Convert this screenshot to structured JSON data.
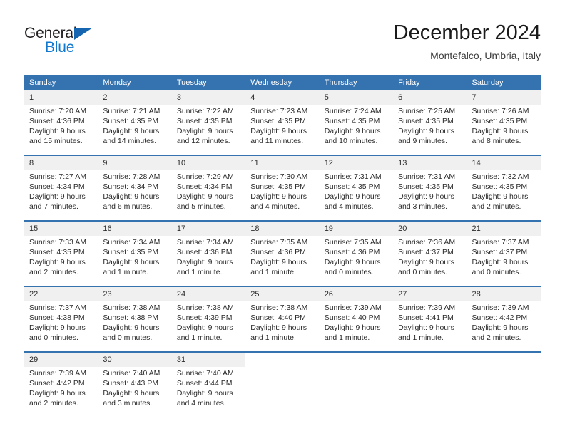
{
  "brand": {
    "name_part1": "General",
    "name_part2": "Blue",
    "triangle_color": "#1565b0",
    "blue_text_color": "#1279cf",
    "dark_text_color": "#231f20"
  },
  "header": {
    "title": "December 2024",
    "subtitle": "Montefalco, Umbria, Italy"
  },
  "theme": {
    "header_band_color": "#3572b0",
    "daynum_band_color": "#f0f0f0",
    "cell_background": "#ffffff",
    "text_color": "#2b2b2b"
  },
  "weekdays": [
    "Sunday",
    "Monday",
    "Tuesday",
    "Wednesday",
    "Thursday",
    "Friday",
    "Saturday"
  ],
  "weeks": [
    {
      "days": [
        {
          "num": "1",
          "sunrise": "Sunrise: 7:20 AM",
          "sunset": "Sunset: 4:36 PM",
          "daylight1": "Daylight: 9 hours",
          "daylight2": "and 15 minutes."
        },
        {
          "num": "2",
          "sunrise": "Sunrise: 7:21 AM",
          "sunset": "Sunset: 4:35 PM",
          "daylight1": "Daylight: 9 hours",
          "daylight2": "and 14 minutes."
        },
        {
          "num": "3",
          "sunrise": "Sunrise: 7:22 AM",
          "sunset": "Sunset: 4:35 PM",
          "daylight1": "Daylight: 9 hours",
          "daylight2": "and 12 minutes."
        },
        {
          "num": "4",
          "sunrise": "Sunrise: 7:23 AM",
          "sunset": "Sunset: 4:35 PM",
          "daylight1": "Daylight: 9 hours",
          "daylight2": "and 11 minutes."
        },
        {
          "num": "5",
          "sunrise": "Sunrise: 7:24 AM",
          "sunset": "Sunset: 4:35 PM",
          "daylight1": "Daylight: 9 hours",
          "daylight2": "and 10 minutes."
        },
        {
          "num": "6",
          "sunrise": "Sunrise: 7:25 AM",
          "sunset": "Sunset: 4:35 PM",
          "daylight1": "Daylight: 9 hours",
          "daylight2": "and 9 minutes."
        },
        {
          "num": "7",
          "sunrise": "Sunrise: 7:26 AM",
          "sunset": "Sunset: 4:35 PM",
          "daylight1": "Daylight: 9 hours",
          "daylight2": "and 8 minutes."
        }
      ]
    },
    {
      "days": [
        {
          "num": "8",
          "sunrise": "Sunrise: 7:27 AM",
          "sunset": "Sunset: 4:34 PM",
          "daylight1": "Daylight: 9 hours",
          "daylight2": "and 7 minutes."
        },
        {
          "num": "9",
          "sunrise": "Sunrise: 7:28 AM",
          "sunset": "Sunset: 4:34 PM",
          "daylight1": "Daylight: 9 hours",
          "daylight2": "and 6 minutes."
        },
        {
          "num": "10",
          "sunrise": "Sunrise: 7:29 AM",
          "sunset": "Sunset: 4:34 PM",
          "daylight1": "Daylight: 9 hours",
          "daylight2": "and 5 minutes."
        },
        {
          "num": "11",
          "sunrise": "Sunrise: 7:30 AM",
          "sunset": "Sunset: 4:35 PM",
          "daylight1": "Daylight: 9 hours",
          "daylight2": "and 4 minutes."
        },
        {
          "num": "12",
          "sunrise": "Sunrise: 7:31 AM",
          "sunset": "Sunset: 4:35 PM",
          "daylight1": "Daylight: 9 hours",
          "daylight2": "and 4 minutes."
        },
        {
          "num": "13",
          "sunrise": "Sunrise: 7:31 AM",
          "sunset": "Sunset: 4:35 PM",
          "daylight1": "Daylight: 9 hours",
          "daylight2": "and 3 minutes."
        },
        {
          "num": "14",
          "sunrise": "Sunrise: 7:32 AM",
          "sunset": "Sunset: 4:35 PM",
          "daylight1": "Daylight: 9 hours",
          "daylight2": "and 2 minutes."
        }
      ]
    },
    {
      "days": [
        {
          "num": "15",
          "sunrise": "Sunrise: 7:33 AM",
          "sunset": "Sunset: 4:35 PM",
          "daylight1": "Daylight: 9 hours",
          "daylight2": "and 2 minutes."
        },
        {
          "num": "16",
          "sunrise": "Sunrise: 7:34 AM",
          "sunset": "Sunset: 4:35 PM",
          "daylight1": "Daylight: 9 hours",
          "daylight2": "and 1 minute."
        },
        {
          "num": "17",
          "sunrise": "Sunrise: 7:34 AM",
          "sunset": "Sunset: 4:36 PM",
          "daylight1": "Daylight: 9 hours",
          "daylight2": "and 1 minute."
        },
        {
          "num": "18",
          "sunrise": "Sunrise: 7:35 AM",
          "sunset": "Sunset: 4:36 PM",
          "daylight1": "Daylight: 9 hours",
          "daylight2": "and 1 minute."
        },
        {
          "num": "19",
          "sunrise": "Sunrise: 7:35 AM",
          "sunset": "Sunset: 4:36 PM",
          "daylight1": "Daylight: 9 hours",
          "daylight2": "and 0 minutes."
        },
        {
          "num": "20",
          "sunrise": "Sunrise: 7:36 AM",
          "sunset": "Sunset: 4:37 PM",
          "daylight1": "Daylight: 9 hours",
          "daylight2": "and 0 minutes."
        },
        {
          "num": "21",
          "sunrise": "Sunrise: 7:37 AM",
          "sunset": "Sunset: 4:37 PM",
          "daylight1": "Daylight: 9 hours",
          "daylight2": "and 0 minutes."
        }
      ]
    },
    {
      "days": [
        {
          "num": "22",
          "sunrise": "Sunrise: 7:37 AM",
          "sunset": "Sunset: 4:38 PM",
          "daylight1": "Daylight: 9 hours",
          "daylight2": "and 0 minutes."
        },
        {
          "num": "23",
          "sunrise": "Sunrise: 7:38 AM",
          "sunset": "Sunset: 4:38 PM",
          "daylight1": "Daylight: 9 hours",
          "daylight2": "and 0 minutes."
        },
        {
          "num": "24",
          "sunrise": "Sunrise: 7:38 AM",
          "sunset": "Sunset: 4:39 PM",
          "daylight1": "Daylight: 9 hours",
          "daylight2": "and 1 minute."
        },
        {
          "num": "25",
          "sunrise": "Sunrise: 7:38 AM",
          "sunset": "Sunset: 4:40 PM",
          "daylight1": "Daylight: 9 hours",
          "daylight2": "and 1 minute."
        },
        {
          "num": "26",
          "sunrise": "Sunrise: 7:39 AM",
          "sunset": "Sunset: 4:40 PM",
          "daylight1": "Daylight: 9 hours",
          "daylight2": "and 1 minute."
        },
        {
          "num": "27",
          "sunrise": "Sunrise: 7:39 AM",
          "sunset": "Sunset: 4:41 PM",
          "daylight1": "Daylight: 9 hours",
          "daylight2": "and 1 minute."
        },
        {
          "num": "28",
          "sunrise": "Sunrise: 7:39 AM",
          "sunset": "Sunset: 4:42 PM",
          "daylight1": "Daylight: 9 hours",
          "daylight2": "and 2 minutes."
        }
      ]
    },
    {
      "days": [
        {
          "num": "29",
          "sunrise": "Sunrise: 7:39 AM",
          "sunset": "Sunset: 4:42 PM",
          "daylight1": "Daylight: 9 hours",
          "daylight2": "and 2 minutes."
        },
        {
          "num": "30",
          "sunrise": "Sunrise: 7:40 AM",
          "sunset": "Sunset: 4:43 PM",
          "daylight1": "Daylight: 9 hours",
          "daylight2": "and 3 minutes."
        },
        {
          "num": "31",
          "sunrise": "Sunrise: 7:40 AM",
          "sunset": "Sunset: 4:44 PM",
          "daylight1": "Daylight: 9 hours",
          "daylight2": "and 4 minutes."
        },
        {
          "num": "",
          "sunrise": "",
          "sunset": "",
          "daylight1": "",
          "daylight2": ""
        },
        {
          "num": "",
          "sunrise": "",
          "sunset": "",
          "daylight1": "",
          "daylight2": ""
        },
        {
          "num": "",
          "sunrise": "",
          "sunset": "",
          "daylight1": "",
          "daylight2": ""
        },
        {
          "num": "",
          "sunrise": "",
          "sunset": "",
          "daylight1": "",
          "daylight2": ""
        }
      ]
    }
  ]
}
